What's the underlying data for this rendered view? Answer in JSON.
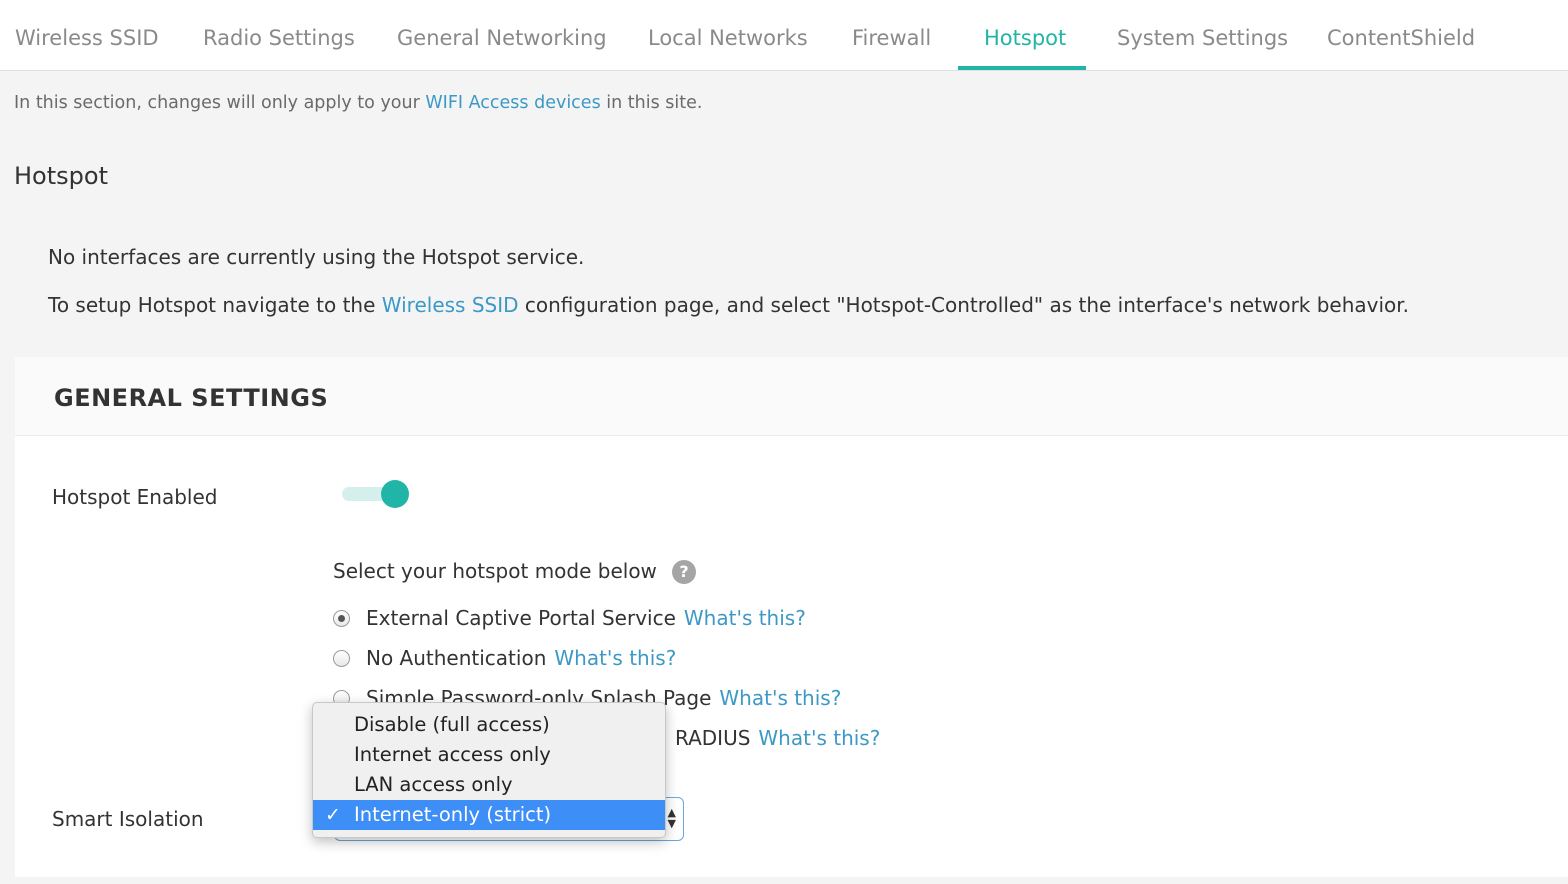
{
  "tabs": [
    {
      "label": "Wireless SSID"
    },
    {
      "label": "Radio Settings"
    },
    {
      "label": "General Networking"
    },
    {
      "label": "Local Networks"
    },
    {
      "label": "Firewall"
    },
    {
      "label": "Hotspot",
      "active": true
    },
    {
      "label": "System Settings"
    },
    {
      "label": "ContentShield"
    }
  ],
  "notice": {
    "prefix": "In this section, changes will only apply to your ",
    "link": "WIFI Access devices",
    "suffix": " in this site."
  },
  "section_title": "Hotspot",
  "info": {
    "line1": "No interfaces are currently using the Hotspot service.",
    "line2_prefix": "To setup Hotspot navigate to the ",
    "line2_link": "Wireless SSID",
    "line2_suffix": " configuration page, and select \"Hotspot-Controlled\" as the interface's network behavior."
  },
  "general_settings": {
    "title": "GENERAL SETTINGS",
    "hotspot_enabled_label": "Hotspot Enabled",
    "hotspot_enabled": true,
    "mode_prompt": "Select your hotspot mode below",
    "help_glyph": "?",
    "modes": [
      {
        "label": "External Captive Portal Service",
        "link": "What's this?",
        "checked": true
      },
      {
        "label": "No Authentication",
        "link": "What's this?",
        "checked": false
      },
      {
        "label": "Simple Password-only Splash Page",
        "link": "What's this?",
        "checked": false
      },
      {
        "label": "RADIUS",
        "link": "What's this?",
        "checked": false
      }
    ],
    "smart_isolation_label": "Smart Isolation",
    "smart_isolation": {
      "selected": "Internet-only (strict)",
      "options": [
        "Disable (full access)",
        "Internet access only",
        "LAN access only",
        "Internet-only (strict)"
      ]
    }
  },
  "colors": {
    "accent": "#21b5a8",
    "link": "#3c99c6",
    "selection": "#3d8ef7"
  }
}
